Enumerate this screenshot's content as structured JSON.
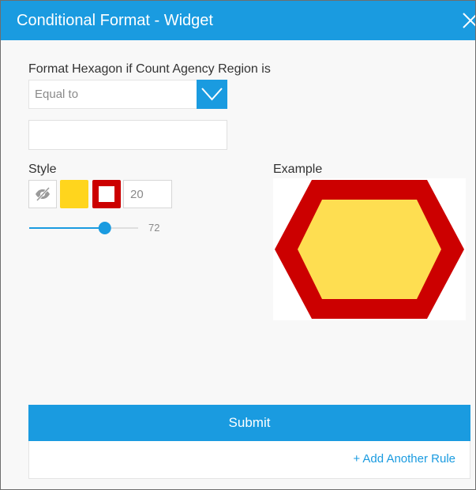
{
  "dialog": {
    "title": "Conditional Format - Widget",
    "close_icon": "close-icon",
    "title_bar_color": "#1a9be0"
  },
  "condition": {
    "label": "Format Hexagon if Count Agency Region is",
    "operator": "Equal to",
    "operator_toggle_icon": "chevron-down-icon",
    "value": "",
    "value_placeholder": ""
  },
  "style": {
    "label": "Style",
    "visibility_icon": "eye-slash-icon",
    "fill_color": "#ffd51d",
    "border_color": "#cc0000",
    "border_width": "20",
    "opacity": 72,
    "opacity_label": "72"
  },
  "example": {
    "label": "Example",
    "shape": "hexagon",
    "fill_color": "#fede51",
    "border_color": "#cc0000"
  },
  "actions": {
    "submit_label": "Submit",
    "add_rule_label": "+ Add Another Rule",
    "accent_color": "#1a9be0"
  }
}
